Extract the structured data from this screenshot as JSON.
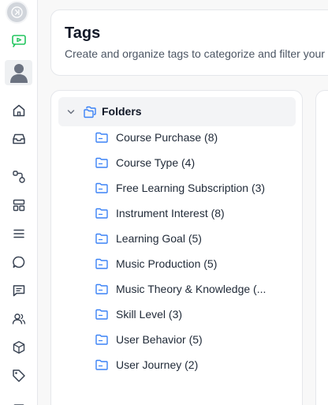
{
  "header": {
    "title": "Tags",
    "subtitle": "Create and organize tags to categorize and filter your"
  },
  "folders": {
    "label": "Folders",
    "items": [
      {
        "label": "Course Purchase (8)"
      },
      {
        "label": "Course Type (4)"
      },
      {
        "label": "Free Learning Subscription (3)"
      },
      {
        "label": "Instrument Interest (8)"
      },
      {
        "label": "Learning Goal (5)"
      },
      {
        "label": "Music Production (5)"
      },
      {
        "label": "Music Theory & Knowledge (..."
      },
      {
        "label": "Skill Level (3)"
      },
      {
        "label": "User Behavior (5)"
      },
      {
        "label": "User Journey (2)"
      }
    ]
  },
  "sidebar": {
    "icons": [
      "collapse-icon",
      "video-icon",
      "avatar",
      "home-icon",
      "inbox-icon",
      "workflow-icon",
      "layout-icon",
      "list-icon",
      "chat-icon",
      "message-icon",
      "contacts-icon",
      "box-icon",
      "tag-icon",
      "more-icon"
    ]
  },
  "colors": {
    "accent": "#3b82f6",
    "accent_green": "#22c55e",
    "text": "#1f2937",
    "muted": "#4b5563"
  }
}
